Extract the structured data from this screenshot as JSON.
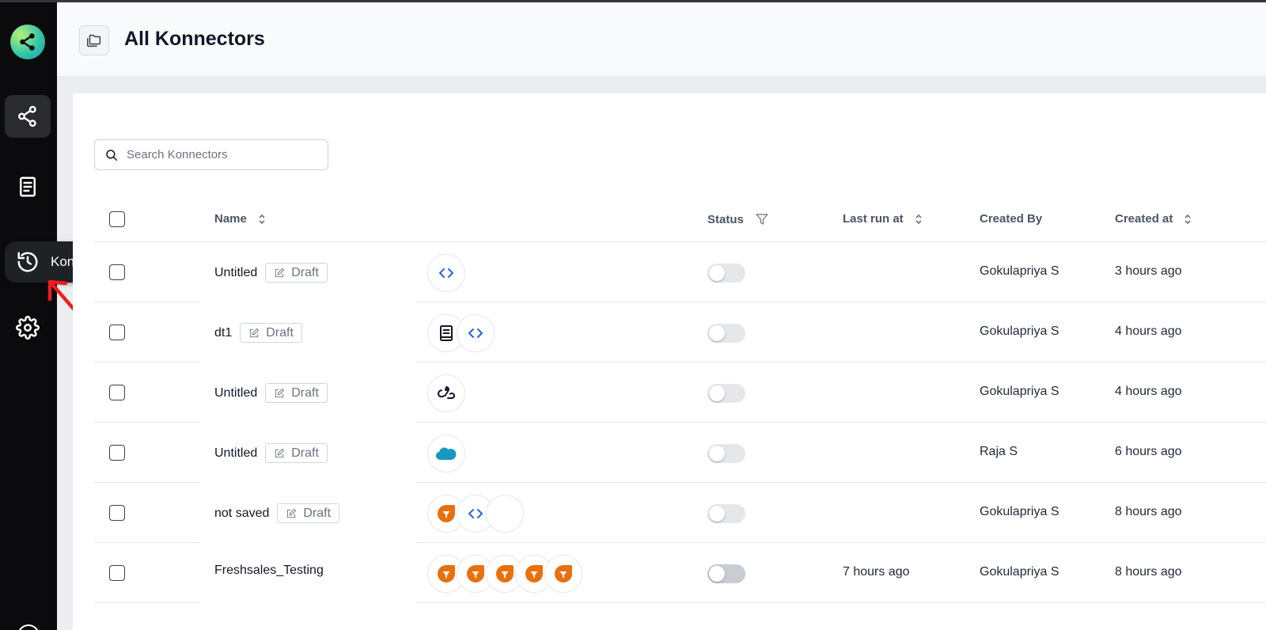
{
  "sidebar": {
    "items": [
      {
        "name": "konnectors",
        "icon": "share-nodes-icon",
        "active": true
      },
      {
        "name": "templates",
        "icon": "document-icon",
        "active": false
      },
      {
        "name": "konnector-history",
        "icon": "history-icon",
        "active": false
      },
      {
        "name": "settings",
        "icon": "gear-icon",
        "active": false
      }
    ],
    "tooltip": "Konnector history"
  },
  "header": {
    "title": "All Konnectors",
    "icon": "folders-icon"
  },
  "search": {
    "placeholder": "Search Konnectors"
  },
  "table": {
    "columns": {
      "name": "Name",
      "status": "Status",
      "last_run": "Last run at",
      "created_by": "Created By",
      "created_at": "Created at"
    },
    "draft_label": "Draft",
    "rows": [
      {
        "name": "Untitled",
        "draft": true,
        "apps": [
          "code-icon"
        ],
        "status": "off",
        "last_run": "",
        "created_by": "Gokulapriya S",
        "created_at": "3 hours ago"
      },
      {
        "name": "dt1",
        "draft": true,
        "apps": [
          "book-icon",
          "code-icon"
        ],
        "status": "off",
        "last_run": "",
        "created_by": "Gokulapriya S",
        "created_at": "4 hours ago"
      },
      {
        "name": "Untitled",
        "draft": true,
        "apps": [
          "webhook-icon"
        ],
        "status": "off",
        "last_run": "",
        "created_by": "Gokulapriya S",
        "created_at": "4 hours ago"
      },
      {
        "name": "Untitled",
        "draft": true,
        "apps": [
          "salesforce-icon"
        ],
        "status": "off",
        "last_run": "",
        "created_by": "Raja S",
        "created_at": "6 hours ago"
      },
      {
        "name": "not saved",
        "draft": true,
        "apps": [
          "freshsales-icon",
          "code-icon",
          "empty-app-icon"
        ],
        "status": "off",
        "last_run": "",
        "created_by": "Gokulapriya S",
        "created_at": "8 hours ago"
      },
      {
        "name": "Freshsales_Testing",
        "draft": false,
        "apps": [
          "freshsales-icon",
          "freshsales-icon",
          "freshsales-icon",
          "freshsales-icon",
          "freshsales-icon"
        ],
        "status": "off",
        "last_run": "7 hours ago",
        "created_by": "Gokulapriya S",
        "created_at": "8 hours ago"
      }
    ]
  },
  "colors": {
    "sidebar": "#0b0b0d",
    "code_blue": "#2563eb",
    "freshsales_orange": "#e8700e",
    "salesforce_blue": "#1798c1"
  }
}
